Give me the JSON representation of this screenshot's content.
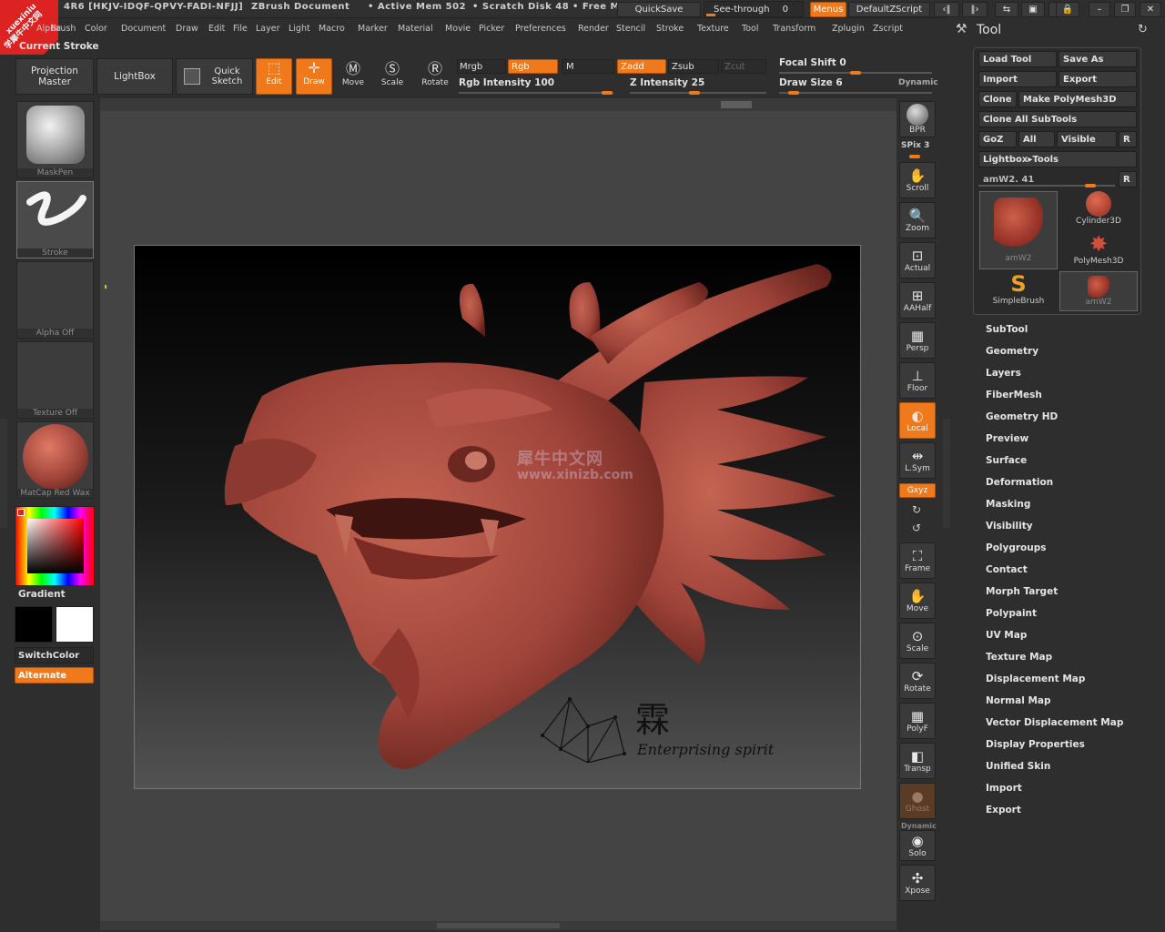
{
  "title_bar": {
    "badge_line1": "xuexiniu",
    "badge_line2": "学犀牛中文网",
    "serial": "4R6 [HKJV-IDQF-QPVY-FADI-NFJJ]",
    "doc": "ZBrush Document",
    "mem": "• Active Mem 502",
    "scratch": "• Scratch Disk 48",
    "free": "• Free M",
    "quicksave": "QuickSave",
    "see_through_label": "See-through",
    "see_through_value": "0",
    "menus": "Menus",
    "zscript": "DefaultZScript",
    "colors": {
      "accent": "#f07a1b",
      "badge": "#d22222"
    }
  },
  "menubar": {
    "items": [
      "Alpha",
      "Brush",
      "Color",
      "Document",
      "Draw",
      "Edit",
      "File",
      "Layer",
      "Light",
      "Macro",
      "Marker",
      "Material",
      "Movie",
      "Picker",
      "Preferences",
      "Render",
      "Stencil",
      "Stroke",
      "Texture",
      "Tool",
      "Transform",
      "Zplugin",
      "Zscript"
    ]
  },
  "current_stroke": "Current Stroke",
  "toolbar": {
    "projection_master": "Projection Master",
    "lightbox": "LightBox",
    "quick_sketch": "Quick Sketch",
    "edit": "Edit",
    "draw": "Draw",
    "move": "Move",
    "scale": "Scale",
    "rotate": "Rotate",
    "mrgb": "Mrgb",
    "rgb": "Rgb",
    "m": "M",
    "zadd": "Zadd",
    "zsub": "Zsub",
    "zcut": "Zcut",
    "rgb_intensity_label": "Rgb Intensity",
    "rgb_intensity_value": "100",
    "z_intensity_label": "Z Intensity",
    "z_intensity_value": "25",
    "focal_shift_label": "Focal Shift",
    "focal_shift_value": "0",
    "draw_size_label": "Draw Size",
    "draw_size_value": "6",
    "dynamic": "Dynamic"
  },
  "left_panel": {
    "brush": "MaskPen",
    "stroke": "Stroke",
    "alpha": "Alpha Off",
    "texture": "Texture Off",
    "material": "MatCap Red Wax",
    "gradient": "Gradient",
    "switch_color": "SwitchColor",
    "alternate": "Alternate"
  },
  "right_shelf": {
    "bpr": "BPR",
    "spix_label": "SPix",
    "spix_value": "3",
    "scroll": "Scroll",
    "zoom": "Zoom",
    "actual": "Actual",
    "aahalf": "AAHalf",
    "persp": "Persp",
    "floor": "Floor",
    "local": "Local",
    "lsym": "L.Sym",
    "xyz": "Gxyz",
    "frame": "Frame",
    "move": "Move",
    "scale": "Scale",
    "rotate": "Rotate",
    "polyf": "PolyF",
    "transp": "Transp",
    "ghost": "Ghost",
    "dynamic": "Dynamic",
    "solo": "Solo",
    "xpose": "Xpose"
  },
  "canvas": {
    "watermark_cn": "犀牛中文网",
    "watermark_url": "www.xinizb.com",
    "logo_char": "霖",
    "logo_text": "Enterprising spirit",
    "model_color": "#a0443a"
  },
  "tool_panel": {
    "title": "Tool",
    "load_tool": "Load Tool",
    "save_as": "Save As",
    "import": "Import",
    "export": "Export",
    "clone": "Clone",
    "make_polymesh": "Make PolyMesh3D",
    "clone_all": "Clone All SubTools",
    "goz": "GoZ",
    "all": "All",
    "visible": "Visible",
    "r": "R",
    "lightbox_tools": "Lightbox▸Tools",
    "current_tool_label": "amW2.",
    "current_tool_value": "41",
    "thumbs": {
      "amw2_a": "amW2",
      "cylinder": "Cylinder3D",
      "polymesh": "PolyMesh3D",
      "simplebrush": "SimpleBrush",
      "amw2_b": "amW2"
    },
    "submenus": [
      "SubTool",
      "Geometry",
      "Layers",
      "FiberMesh",
      "Geometry HD",
      "Preview",
      "Surface",
      "Deformation",
      "Masking",
      "Visibility",
      "Polygroups",
      "Contact",
      "Morph Target",
      "Polypaint",
      "UV Map",
      "Texture Map",
      "Displacement Map",
      "Normal Map",
      "Vector Displacement Map",
      "Display Properties",
      "Unified Skin",
      "Import",
      "Export"
    ]
  }
}
